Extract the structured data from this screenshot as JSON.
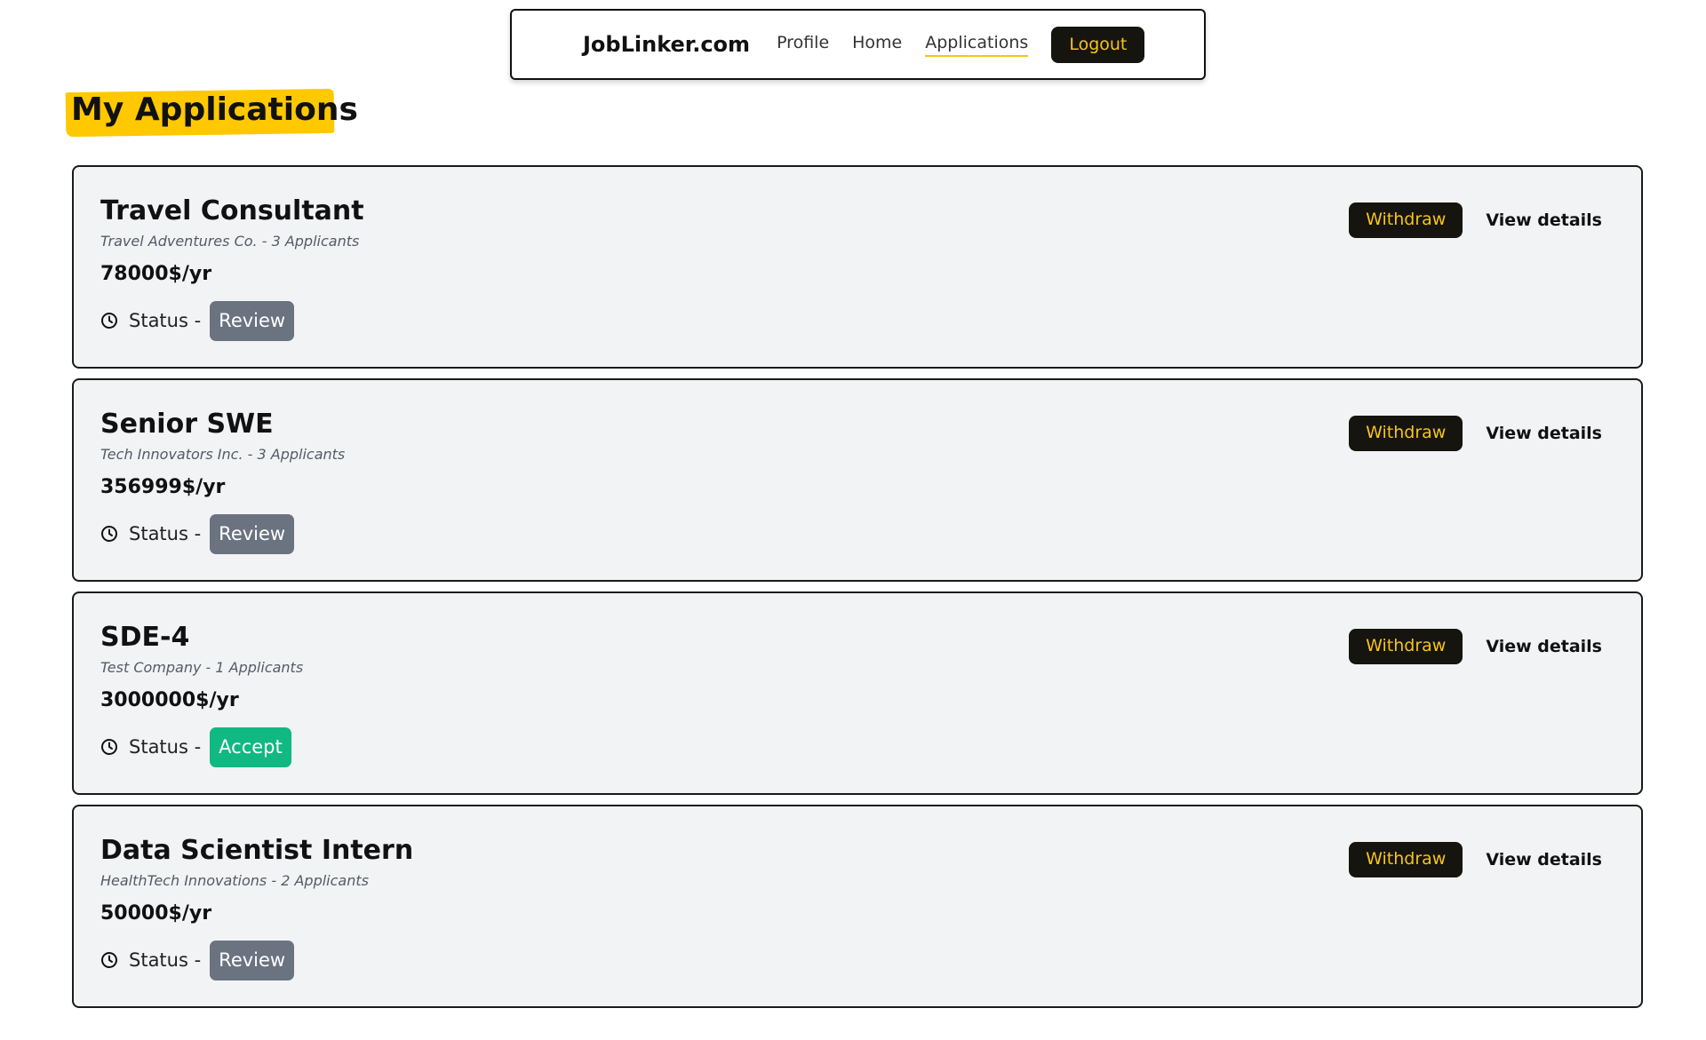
{
  "nav": {
    "brand": "JobLinker.com",
    "links": [
      "Profile",
      "Home",
      "Applications"
    ],
    "active_link": "Applications",
    "logout_label": "Logout"
  },
  "page_title": "My Applications",
  "status_prefix": "Status -",
  "actions": {
    "withdraw_label": "Withdraw",
    "details_label": "View details"
  },
  "applications": [
    {
      "title": "Travel Consultant",
      "meta": "Travel Adventures Co. - 3 Applicants",
      "salary": "78000$/yr",
      "status": "Review"
    },
    {
      "title": "Senior SWE",
      "meta": "Tech Innovators Inc. - 3 Applicants",
      "salary": "356999$/yr",
      "status": "Review"
    },
    {
      "title": "SDE-4",
      "meta": "Test Company - 1 Applicants",
      "salary": "3000000$/yr",
      "status": "Accept"
    },
    {
      "title": "Data Scientist Intern",
      "meta": "HealthTech Innovations - 2 Applicants",
      "salary": "50000$/yr",
      "status": "Review"
    }
  ],
  "icons": {
    "status": "clock-icon"
  },
  "colors": {
    "accent": "#f5c518",
    "highlight": "#ffc800",
    "dark_button": "#16140f",
    "status_review": "#6b7280",
    "status_accept": "#10b981",
    "card_bg": "#f2f3f5"
  }
}
